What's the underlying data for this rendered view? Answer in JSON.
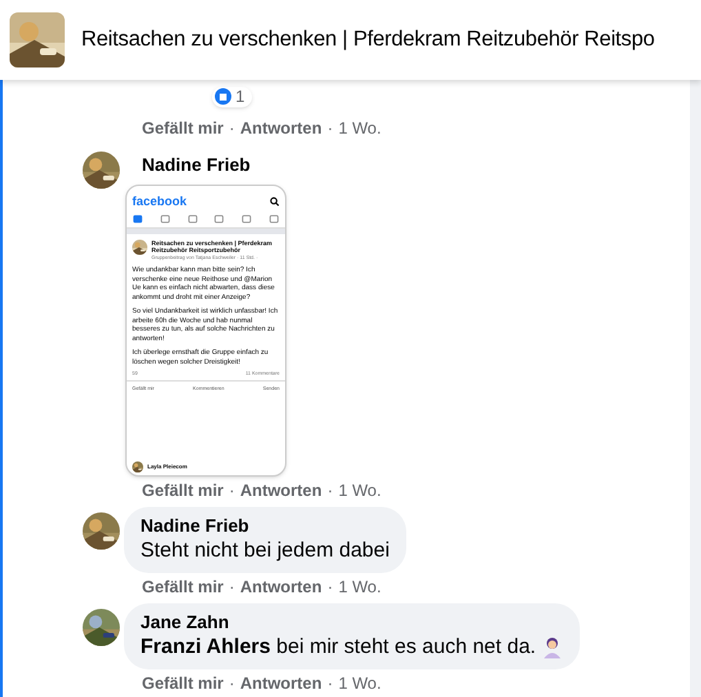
{
  "group": {
    "title": "Reitsachen zu verschenken | Pferdekram Reitzubehör Reitspo"
  },
  "previous_comment": {
    "reaction_count": "1",
    "actions": {
      "like": "Gefällt mir",
      "separator": "·",
      "reply": "Antworten",
      "time": "1 Wo."
    }
  },
  "comments": [
    {
      "author": "Nadine Frieb",
      "screenshot": {
        "brand": "facebook",
        "nav_tabs": [
          {
            "selected": true
          },
          {
            "selected": false
          },
          {
            "selected": false
          },
          {
            "selected": false
          },
          {
            "selected": false
          },
          {
            "selected": false
          }
        ],
        "post": {
          "title": "Reitsachen zu verschenken | Pferdekram Reitzubehör Reitsportzubehör",
          "meta": "Gruppenbeitrag von Tatjana Eschweiler · 11 Std. ·",
          "paragraphs": [
            "Wie undankbar kann man bitte sein? Ich verschenke eine neue Reithose und @Marion Ue kann es einfach nicht abwarten, dass diese ankommt und droht mit einer Anzeige?",
            "So viel Undankbarkeit ist wirklich unfassbar! Ich arbeite 60h die Woche und hab nunmal besseres zu tun, als auf solche Nachrichten zu antworten!",
            "Ich überlege ernsthaft die Gruppe einfach zu löschen wegen solcher Dreistigkeit!"
          ],
          "reaction_count": "59",
          "comment_count": "11 Kommentare",
          "actions": [
            "Gefällt mir",
            "Kommentieren",
            "Senden"
          ]
        },
        "next_commenter": "Layla Pleiecom"
      },
      "actions": {
        "like": "Gefällt mir",
        "separator": "·",
        "reply": "Antworten",
        "time": "1 Wo."
      }
    },
    {
      "kind": "text",
      "author": "Nadine Frieb",
      "text": "Steht nicht bei jedem dabei",
      "actions": {
        "like": "Gefällt mir",
        "separator": "·",
        "reply": "Antworten",
        "time": "1 Wo."
      }
    },
    {
      "kind": "text",
      "author": "Jane Zahn",
      "text": "**Franzi Ahlers** bei mir steht es auch net da.",
      "emoji": true,
      "actions": {
        "like": "Gefällt mir",
        "separator": "·",
        "reply": "Antworten",
        "time": "1 Wo."
      }
    }
  ]
}
